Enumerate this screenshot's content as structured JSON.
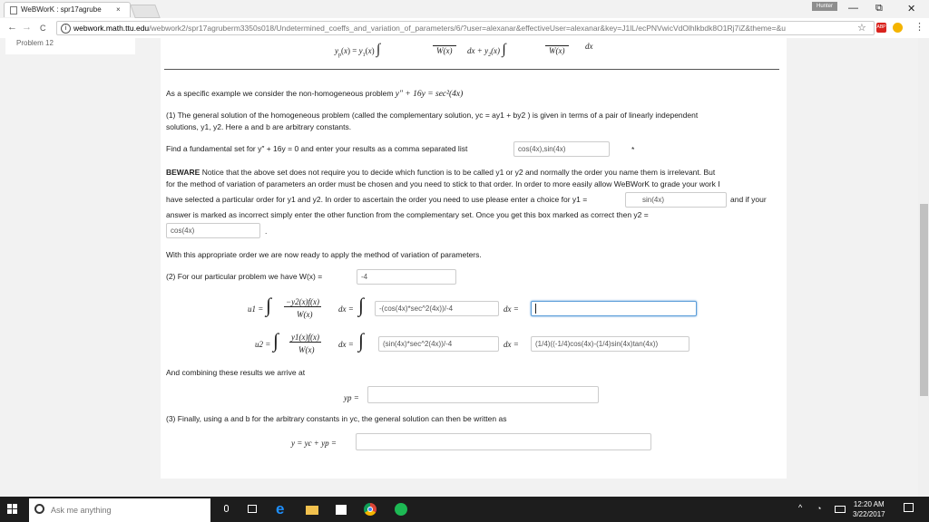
{
  "browser": {
    "tab_title": "WeBWorK : spr17agrube",
    "tab_close": "×",
    "user_badge": "Hunter",
    "minimize": "—",
    "maximize": "⧉",
    "close": "✕",
    "back": "←",
    "forward": "→",
    "reload": "C",
    "info": "i",
    "url_domain": "webwork.math.ttu.edu",
    "url_path": "/webwork2/spr17agruberm3350s018/Undetermined_coeffs_and_variation_of_parameters/6/?user=alexanar&effectiveUser=alexanar&key=J1lL/ecPNVwicVdOlhlkbdk8O1Rj7iZ&theme=&u",
    "star": "☆",
    "abp": "ABP",
    "menu": "⋮"
  },
  "sidebar": {
    "problem_label": "Problem 12"
  },
  "problem": {
    "formula_top": "yp(x) = y1(x) ∫ ... dx + y2(x) ∫ ... dx",
    "w_denom": "W(x)",
    "intro_prefix": "As a specific example we consider the non-homogeneous problem",
    "intro_eq": "y″ + 16y = sec²(4x)",
    "part1_line1": "(1) The general solution of the homogeneous problem (called the complementary solution, yc = ay1 + by2 ) is given in terms of a pair of linearly independent",
    "part1_line2": "solutions, y1, y2. Here a and b are arbitrary constants.",
    "fund_prompt": "Find a fundamental set for y″ + 16y = 0 and enter your results as a comma separated list",
    "fund_answer": "cos(4x),sin(4x)",
    "fund_mark": "*",
    "beware_label": "BEWARE",
    "beware_line1": "Notice that the above set does not require you to decide which function is to be called y1 or y2 and normally the order you name them is irrelevant. But",
    "beware_line2": "for the method of variation of parameters an order must be chosen and you need to stick to that order. In order to more easily allow WeBWorK to grade your work I",
    "beware_line3": "have selected a particular order for y1 and y2. In order to ascertain the order you need to use please enter a choice for y1 =",
    "y1_answer": "sin(4x)",
    "beware_line3b": "and if your",
    "beware_line4": "answer is marked as incorrect simply enter the other function from the complementary set. Once you get this box marked as correct then y2 =",
    "y2_answer": "cos(4x)",
    "period": ".",
    "ready_text": "With this appropriate order we are now ready to apply the method of variation of parameters.",
    "part2_text": "(2) For our particular problem we have W(x) =",
    "w_answer": "-4",
    "u1_label": "u1 =",
    "u1_num": "−y2(x)f(x)",
    "u1_denom": "W(x)",
    "dx_eq": "dx =",
    "u1_answer": "-(cos(4x)*sec^2(4x))/-4",
    "dx_eq2": "dx =",
    "u1_result": "",
    "u2_label": "u2 =",
    "u2_num": "y1(x)f(x)",
    "u2_denom": "W(x)",
    "u2_answer": "(sin(4x)*sec^2(4x))/-4",
    "u2_result": "(1/4)((-1/4)cos(4x)-(1/4)sin(4x)tan(4x))",
    "combine_text": "And combining these results we arrive at",
    "yp_label": "yp =",
    "yp_answer": "",
    "part3_text": "(3) Finally, using a and b for the arbitrary constants in yc, the general solution can then be written as",
    "y_label": "y = yc + yp =",
    "y_answer": ""
  },
  "taskbar": {
    "search_placeholder": "Ask me anything",
    "time": "12:20 AM",
    "date": "3/22/2017"
  }
}
